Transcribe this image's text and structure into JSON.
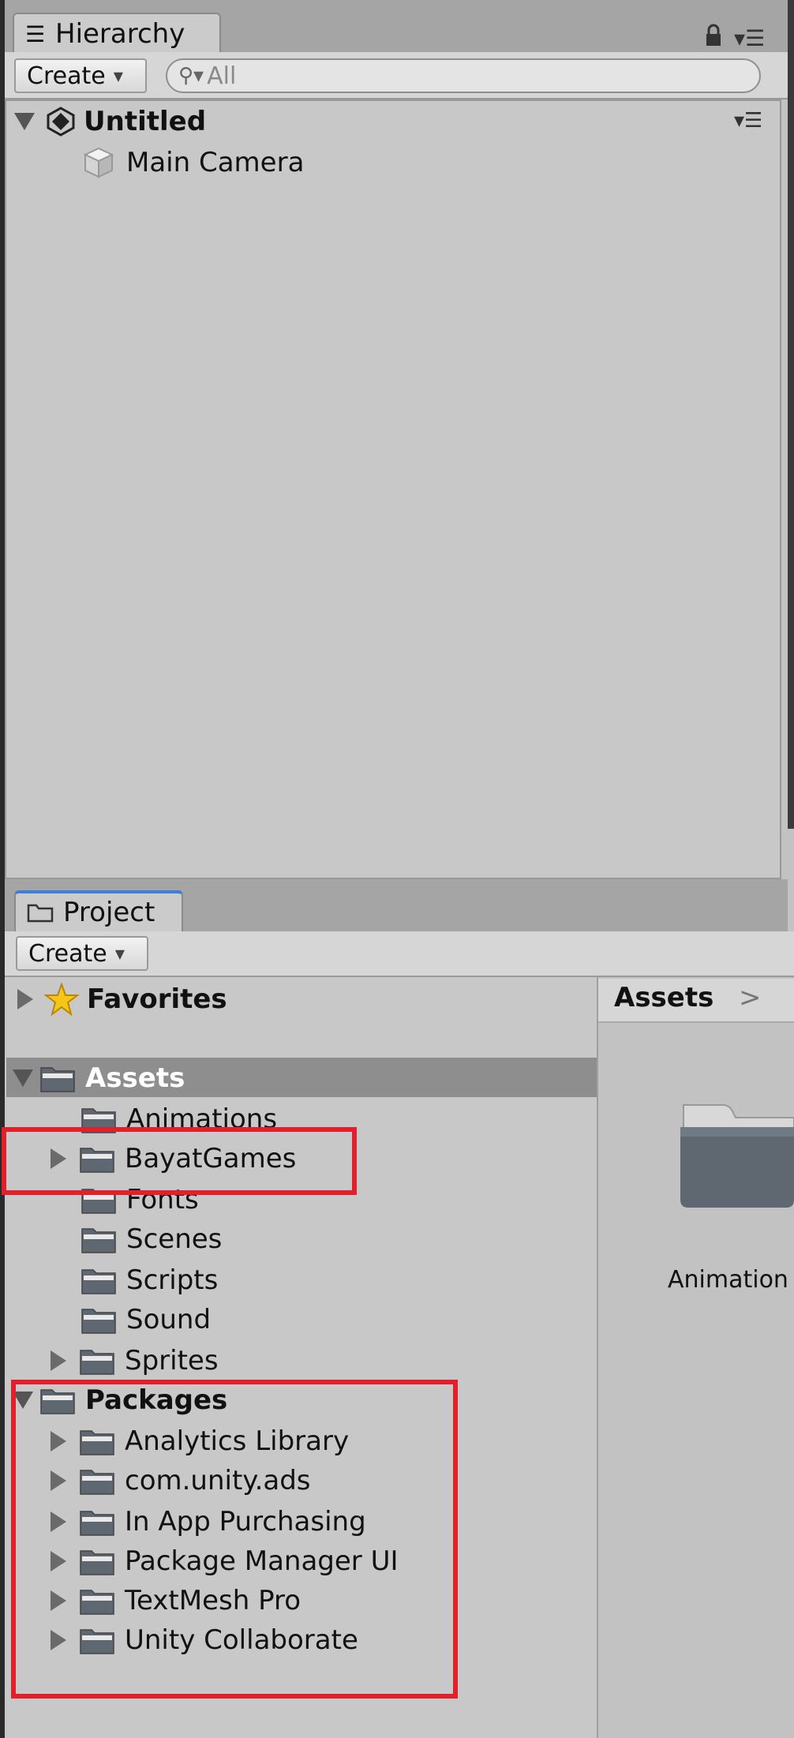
{
  "hierarchy": {
    "tab_title": "Hierarchy",
    "create_label": "Create",
    "search_placeholder": "All",
    "scene_name": "Untitled",
    "objects": [
      "Main Camera"
    ]
  },
  "project": {
    "tab_title": "Project",
    "create_label": "Create",
    "favorites_label": "Favorites",
    "assets_label": "Assets",
    "asset_folders": [
      {
        "name": "Animations",
        "expandable": false
      },
      {
        "name": "BayatGames",
        "expandable": true
      },
      {
        "name": "Fonts",
        "expandable": false
      },
      {
        "name": "Scenes",
        "expandable": false
      },
      {
        "name": "Scripts",
        "expandable": false
      },
      {
        "name": "Sound",
        "expandable": false
      },
      {
        "name": "Sprites",
        "expandable": true
      }
    ],
    "packages_label": "Packages",
    "package_folders": [
      {
        "name": "Analytics Library"
      },
      {
        "name": "com.unity.ads"
      },
      {
        "name": "In App Purchasing"
      },
      {
        "name": "Package Manager UI"
      },
      {
        "name": "TextMesh Pro"
      },
      {
        "name": "Unity Collaborate"
      }
    ],
    "breadcrumb": "Assets",
    "grid_items": [
      "Animation"
    ]
  },
  "colors": {
    "highlight_box": "#e0202a",
    "selected_row": "#8e8e8e",
    "tab_accent": "#3d7fd4"
  },
  "icons": [
    "list-icon",
    "lock-icon",
    "panel-menu-icon",
    "search-icon",
    "unity-scene-icon",
    "gameobject-cube-icon",
    "folder-icon",
    "star-icon",
    "chevron-right-icon"
  ]
}
